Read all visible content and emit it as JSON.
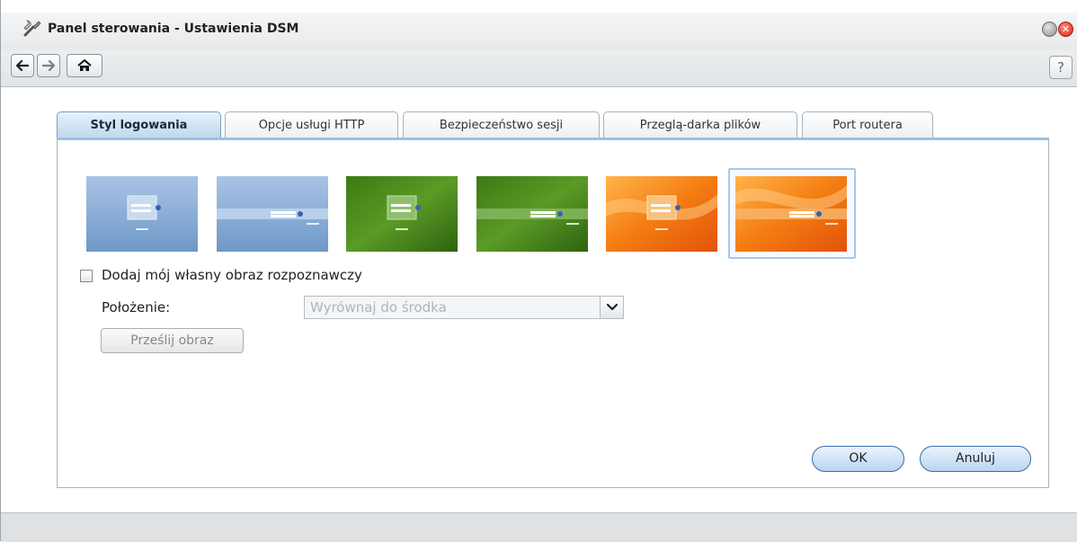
{
  "window": {
    "title": "Panel sterowania - Ustawienia DSM",
    "app_icon": "tools-icon"
  },
  "toolbar": {
    "back_icon": "arrow-left-icon",
    "forward_icon": "arrow-right-icon",
    "home_icon": "home-icon",
    "help_label": "?"
  },
  "tabs": [
    {
      "label": "Styl logowania",
      "active": true
    },
    {
      "label": "Opcje usługi HTTP",
      "active": false
    },
    {
      "label": "Bezpieczeństwo sesji",
      "active": false
    },
    {
      "label": "Przeglą-darka plików",
      "active": false
    },
    {
      "label": "Port routera",
      "active": false
    }
  ],
  "login_styles": [
    {
      "name": "blue-box",
      "color": "#7fa8d6"
    },
    {
      "name": "blue-bar",
      "color": "#7fa8d6"
    },
    {
      "name": "green-box",
      "color": "#4b8a21"
    },
    {
      "name": "green-bar",
      "color": "#4b8a21"
    },
    {
      "name": "orange-box",
      "color": "#f08a1c"
    },
    {
      "name": "orange-bar",
      "color": "#f08a1c",
      "selected": true
    }
  ],
  "custom_image": {
    "checkbox_label": "Dodaj mój własny obraz rozpoznawczy",
    "checked": false,
    "position_label": "Położenie:",
    "position_value": "Wyrównaj do środka",
    "upload_label": "Prześlij obraz"
  },
  "buttons": {
    "ok": "OK",
    "cancel": "Anuluj"
  },
  "colors": {
    "accent": "#9ec0e2",
    "close": "#d92616"
  }
}
